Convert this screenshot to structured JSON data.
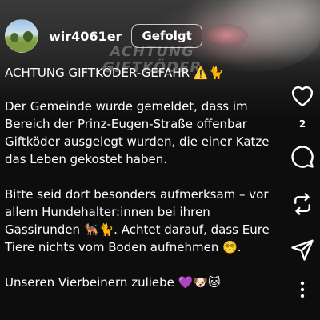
{
  "background": {
    "watermark_line1": "ACHTUNG",
    "watermark_line2": "GIFTKÖDER"
  },
  "header": {
    "username": "wir4061er",
    "follow_label": "Gefolgt",
    "avatar_icon": "landscape-avatar"
  },
  "caption": {
    "title": "ACHTUNG GIFTKÖDER-GEFAHR ⚠️🐈",
    "paragraph1": "Der Gemeinde wurde gemeldet, dass im Bereich der Prinz-Eugen-Straße offenbar Giftköder ausgelegt wurden, die einer Katze das Leben gekostet haben.",
    "paragraph2": "Bitte seid dort besonders aufmerksam – vor allem Hundehalter:innen bei ihren Gassirunden 🐕‍🦺🐈. Achtet darauf, dass Eure Tiere nichts vom Boden aufnehmen 😵‍💫.",
    "paragraph3": "Unseren Vierbeinern zuliebe 💜🐶🐱"
  },
  "actions": {
    "like_icon": "heart-icon",
    "like_count": "2",
    "comment_icon": "comment-icon",
    "repost_icon": "repost-icon",
    "share_icon": "send-icon",
    "more_icon": "more-vertical-icon"
  },
  "colors": {
    "background": "#0d0d0d",
    "text": "#ffffff"
  }
}
